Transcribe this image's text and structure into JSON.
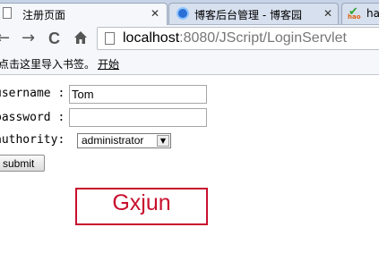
{
  "tabs": [
    {
      "title": "注册页面",
      "active": true
    },
    {
      "title": "博客后台管理 - 博客园",
      "active": false
    },
    {
      "title": "ha",
      "active": false
    }
  ],
  "toolbar": {
    "back_icon": "←",
    "forward_icon": "→",
    "reload_icon": "C",
    "home_icon": "home-icon",
    "url_host": "localhost",
    "url_rest": ":8080/JScript/LoginServlet"
  },
  "bookmarks": {
    "hint": "点击这里导入书签。",
    "import_link": "开始"
  },
  "form": {
    "username_label": "username :",
    "username_value": "Tom",
    "password_label": "password :",
    "password_value": "",
    "authority_label": "authority:",
    "authority_selected": "administrator",
    "submit_label": "submit"
  },
  "banner": {
    "text": "Gxjun"
  },
  "colors": {
    "banner_red": "#c8102e",
    "tab_strip": "#c7d3e6"
  }
}
